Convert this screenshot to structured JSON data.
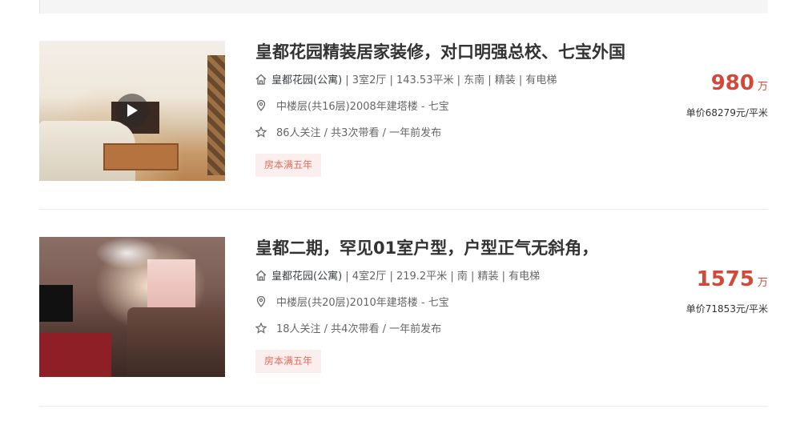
{
  "listings": [
    {
      "title": "皇都花园精装居家装修，对口明强总校、七宝外国",
      "has_video": true,
      "house": {
        "community": "皇都花园(公寓)",
        "details": " | 3室2厅 | 143.53平米 | 东南 | 精装 | 有电梯"
      },
      "position": "中楼层(共16层)2008年建塔楼 - 七宝",
      "follow": "86人关注 / 共3次带看 / 一年前发布",
      "tag": "房本满五年",
      "price": {
        "total": "980",
        "unit": "万",
        "unit_price": "单价68279元/平米"
      }
    },
    {
      "title": "皇都二期，罕见01室户型，户型正气无斜角，",
      "has_video": false,
      "house": {
        "community": "皇都花园(公寓)",
        "details": " | 4室2厅 | 219.2平米 | 南 | 精装 | 有电梯"
      },
      "position": "中楼层(共20层)2010年建塔楼 - 七宝",
      "follow": "18人关注 / 共4次带看 / 一年前发布",
      "tag": "房本满五年",
      "price": {
        "total": "1575",
        "unit": "万",
        "unit_price": "单价71853元/平米"
      }
    }
  ],
  "icons": {
    "house": "house-icon",
    "position": "location-pin-icon",
    "follow": "star-icon",
    "video": "play-icon"
  },
  "colors": {
    "price": "#d4483b",
    "tag_text": "#e46c5e",
    "tag_bg": "#fbefee"
  }
}
